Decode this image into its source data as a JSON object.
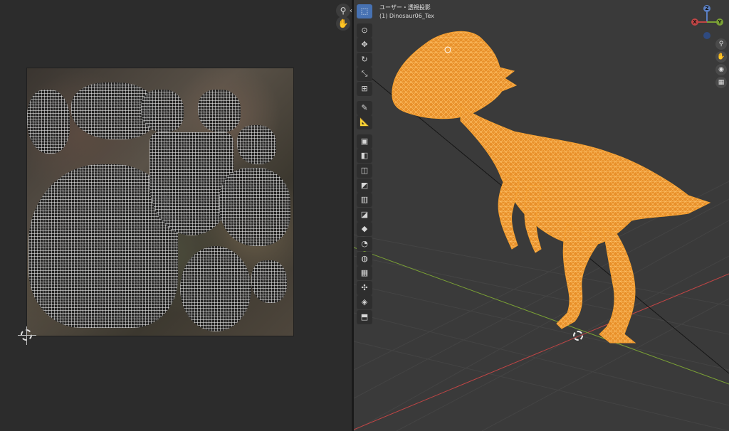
{
  "viewport": {
    "view_label": "ユーザー・透視投影",
    "object_label": "(1) Dinosaur06_Tex"
  },
  "gizmo": {
    "z": "Z",
    "y": "Y",
    "x": "X"
  },
  "icons": {
    "zoom": "magnifier-icon",
    "pan": "hand-icon",
    "area_toggle": "chevron-left-icon",
    "camera": "camera-icon",
    "grid": "grid-icon"
  },
  "toolbar": {
    "tools": [
      {
        "name": "select-box-tool",
        "glyph": "⬚",
        "active": true
      },
      {
        "name": "cursor-tool",
        "glyph": "⊙"
      },
      {
        "name": "move-tool",
        "glyph": "✥"
      },
      {
        "name": "rotate-tool",
        "glyph": "↻"
      },
      {
        "name": "scale-tool",
        "glyph": "⤡"
      },
      {
        "name": "transform-tool",
        "glyph": "⊞"
      },
      {
        "name": "annotate-tool",
        "glyph": "✎"
      },
      {
        "name": "measure-tool",
        "glyph": "📐"
      },
      {
        "name": "add-cube-tool",
        "glyph": "▣"
      },
      {
        "name": "extrude-tool",
        "glyph": "◧"
      },
      {
        "name": "inset-tool",
        "glyph": "◫"
      },
      {
        "name": "bevel-tool",
        "glyph": "◩"
      },
      {
        "name": "loop-cut-tool",
        "glyph": "▥"
      },
      {
        "name": "knife-tool",
        "glyph": "◪"
      },
      {
        "name": "poly-build-tool",
        "glyph": "◆"
      },
      {
        "name": "spin-tool",
        "glyph": "◔"
      },
      {
        "name": "smooth-tool",
        "glyph": "◍"
      },
      {
        "name": "edge-slide-tool",
        "glyph": "▦"
      },
      {
        "name": "shrink-fatten-tool",
        "glyph": "✣"
      },
      {
        "name": "shear-tool",
        "glyph": "◈"
      },
      {
        "name": "rip-region-tool",
        "glyph": "⬒"
      }
    ]
  },
  "colors": {
    "selection": "#f5a030",
    "accent": "#4772b3",
    "x_axis": "#c14545",
    "y_axis": "#7aa035"
  }
}
